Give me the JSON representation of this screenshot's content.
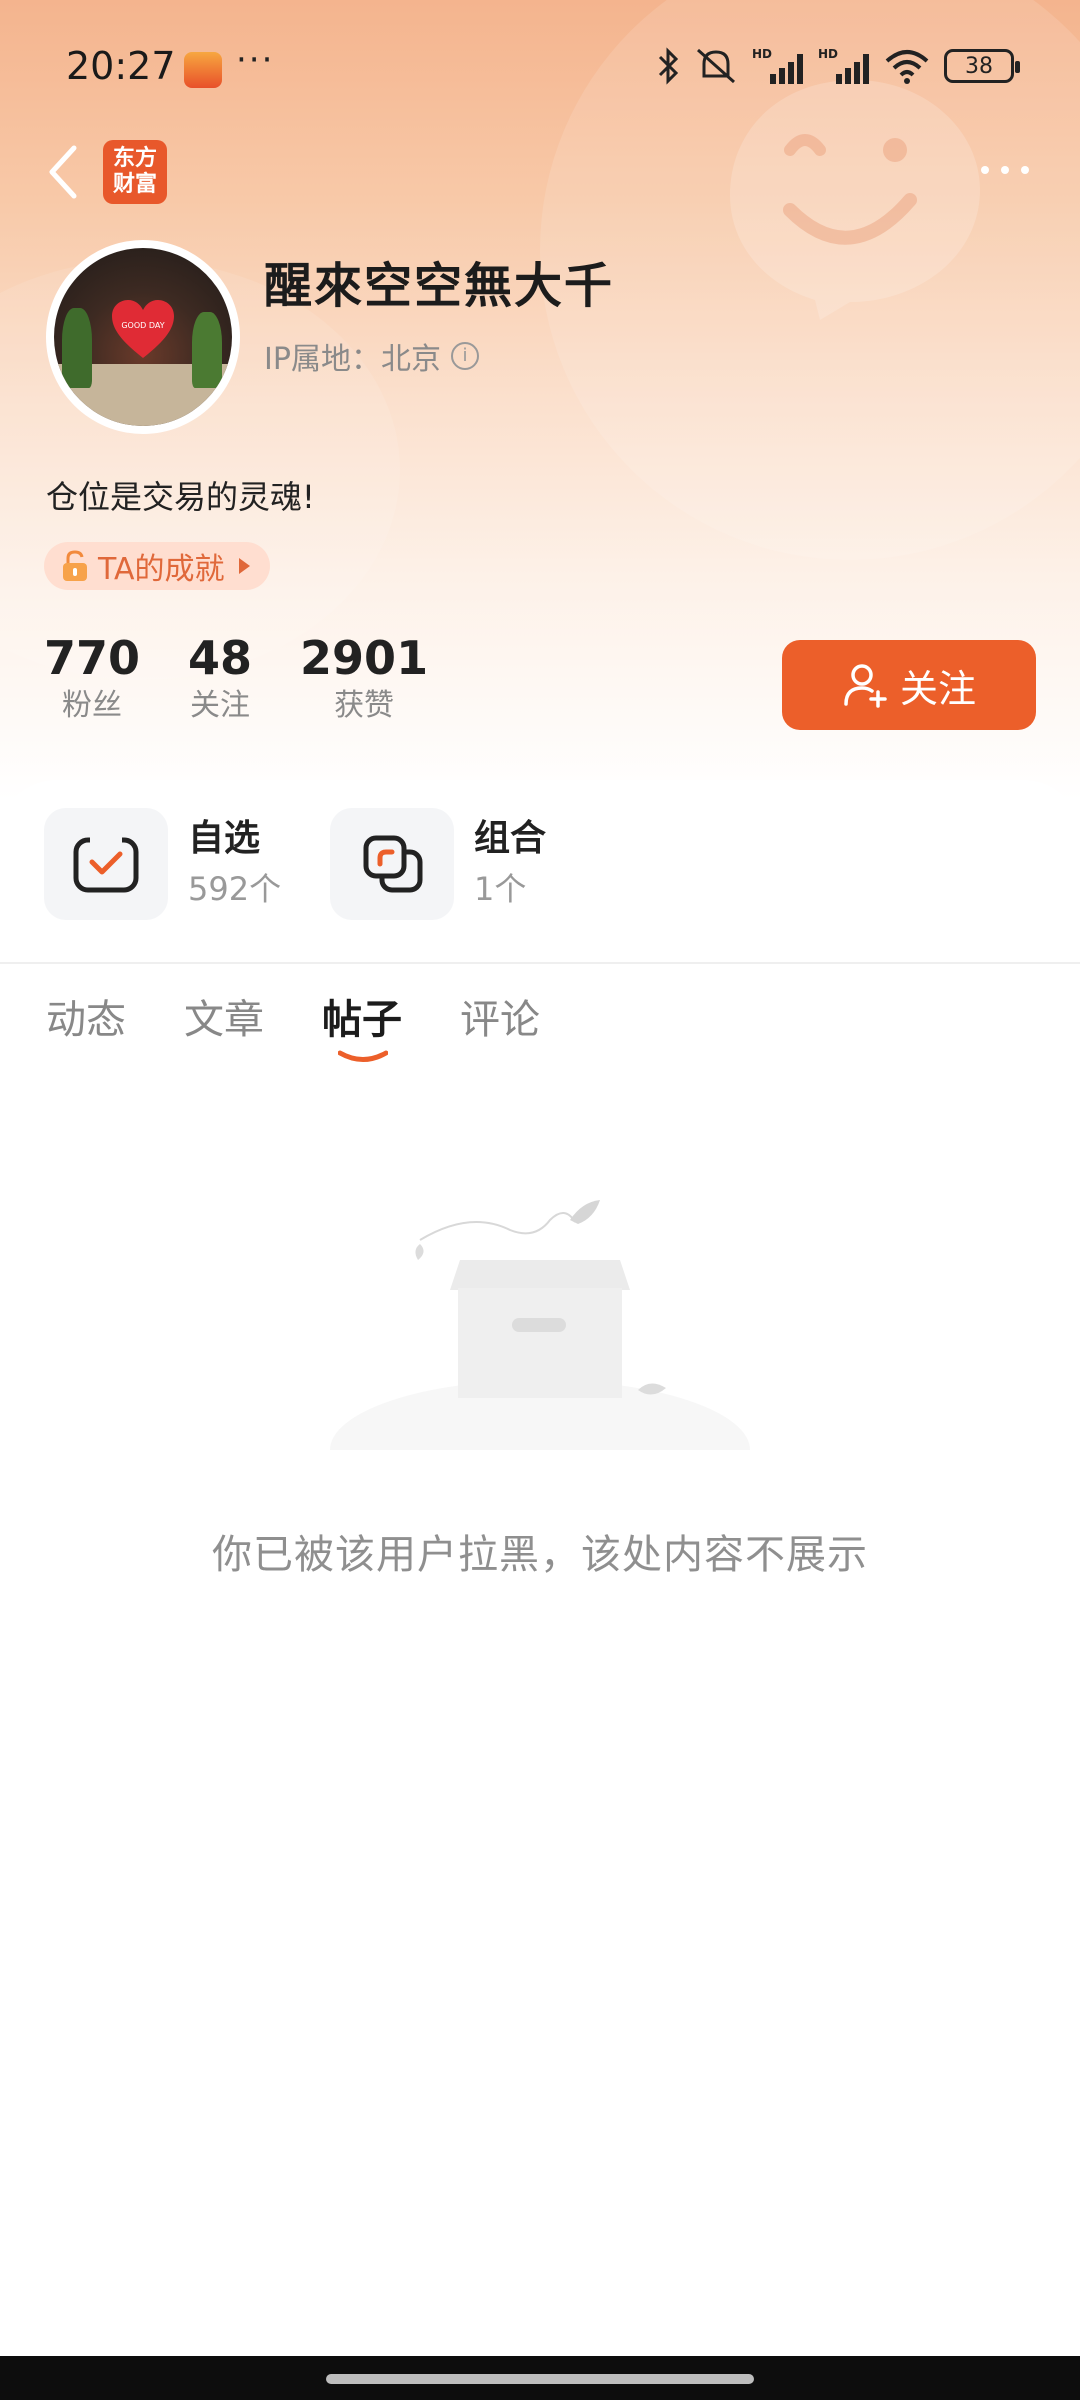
{
  "status_bar": {
    "time": "20:27",
    "dots": "···",
    "battery": "38",
    "icons": [
      "bluetooth-icon",
      "mute-icon",
      "signal-hd-icon",
      "signal-hd-icon",
      "wifi-icon",
      "battery-icon"
    ]
  },
  "nav": {
    "app_logo_line1": "东方",
    "app_logo_line2": "财富"
  },
  "profile": {
    "username": "醒來空空無大千",
    "ip_label": "IP属地：北京",
    "bio": "仓位是交易的灵魂!",
    "achievement_label": "TA的成就",
    "avatar_sign_text": "GOOD DAY"
  },
  "stats": [
    {
      "value": "770",
      "label": "粉丝"
    },
    {
      "value": "48",
      "label": "关注"
    },
    {
      "value": "2901",
      "label": "获赞"
    }
  ],
  "follow_button": {
    "label": "关注"
  },
  "sections": [
    {
      "title": "自选",
      "count": "592个",
      "icon": "checkbox-icon"
    },
    {
      "title": "组合",
      "count": "1个",
      "icon": "portfolio-icon"
    }
  ],
  "tabs": [
    {
      "label": "动态",
      "active": false
    },
    {
      "label": "文章",
      "active": false
    },
    {
      "label": "帖子",
      "active": true
    },
    {
      "label": "评论",
      "active": false
    }
  ],
  "empty_state": {
    "message": "你已被该用户拉黑，该处内容不展示"
  },
  "colors": {
    "accent": "#ec5f2a",
    "header_top": "#f4b48e",
    "muted_text": "#8a8a8a"
  }
}
